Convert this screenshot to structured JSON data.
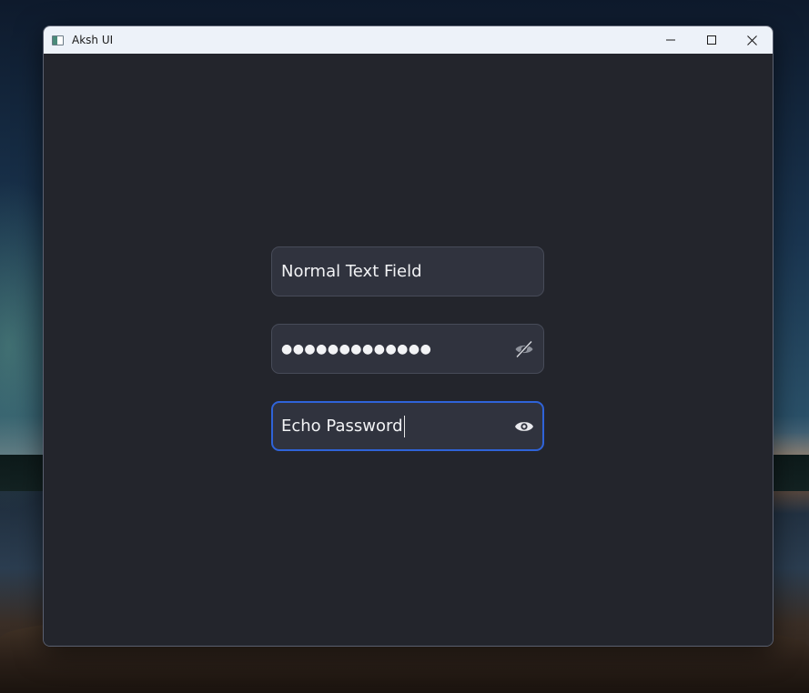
{
  "window": {
    "title": "Aksh UI",
    "icon": "app-window-icon"
  },
  "caption_buttons": {
    "minimize_icon": "minimize-icon",
    "maximize_icon": "maximize-icon",
    "close_icon": "close-icon"
  },
  "fields": {
    "normal": {
      "value": "Normal Text Field"
    },
    "password": {
      "value": "●●●●●●●●●●●●●",
      "toggle_icon": "eye-slash-icon",
      "masked": true
    },
    "echo": {
      "value": "Echo Password",
      "toggle_icon": "eye-icon",
      "masked": false,
      "focused": true
    }
  },
  "colors": {
    "window_background": "#23252c",
    "field_background": "#30333e",
    "field_border": "#474b58",
    "focus_border": "#2f63d8",
    "text": "#f2f3f5",
    "titlebar": "#edf2f9"
  }
}
